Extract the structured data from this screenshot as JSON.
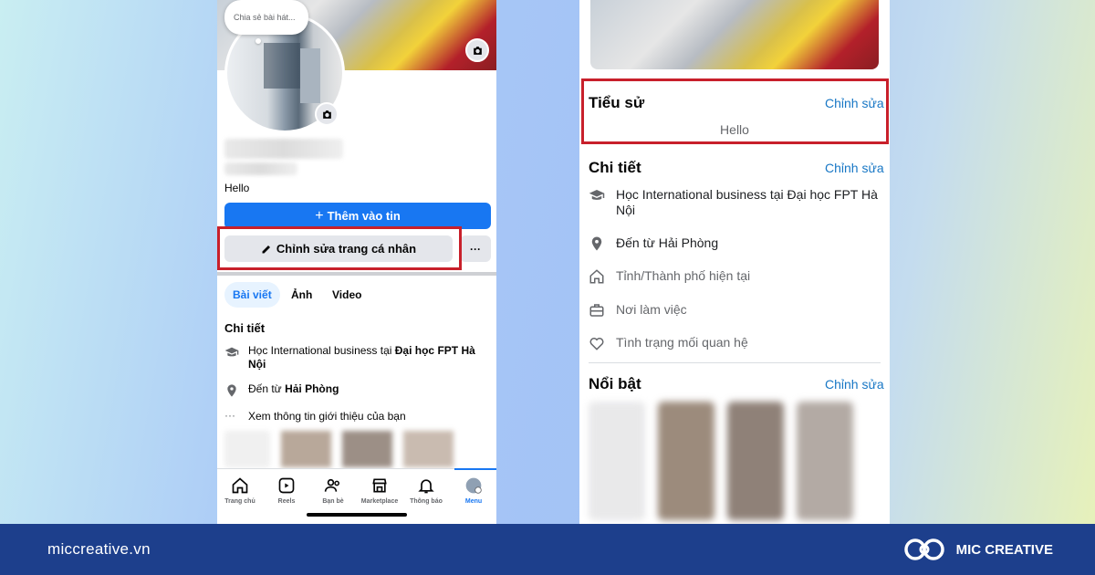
{
  "left": {
    "status_bubble": "Chia sẻ bài hát...",
    "bio": "Hello",
    "add_story_label": "Thêm vào tin",
    "edit_profile_label": "Chỉnh sửa trang cá nhân",
    "more_label": "···",
    "tabs": [
      "Bài viết",
      "Ảnh",
      "Video"
    ],
    "details_title": "Chi tiết",
    "education_prefix": "Học International business tại ",
    "education_school": "Đại học FPT Hà Nội",
    "hometown_prefix": "Đến từ ",
    "hometown_city": "Hải Phòng",
    "see_about": "Xem thông tin giới thiệu của bạn",
    "nav": [
      "Trang chủ",
      "Reels",
      "Bạn bè",
      "Marketplace",
      "Thông báo",
      "Menu"
    ]
  },
  "right": {
    "bio_title": "Tiểu sử",
    "bio_edit": "Chỉnh sửa",
    "bio_text": "Hello",
    "details_title": "Chi tiết",
    "details_edit": "Chỉnh sửa",
    "education": "Học International business tại Đại học FPT Hà Nội",
    "hometown": "Đến từ Hải Phòng",
    "current_city": "Tỉnh/Thành phố hiện tại",
    "workplace": "Nơi làm việc",
    "relationship": "Tình trạng mối quan hệ",
    "featured_title": "Nổi bật",
    "featured_edit": "Chỉnh sửa"
  },
  "footer": {
    "site": "miccreative.vn",
    "brand": "MIC CREATIVE"
  },
  "colors": {
    "accent_blue": "#1877f2",
    "highlight_red": "#c8202b",
    "footer_navy": "#1d3f8c"
  }
}
